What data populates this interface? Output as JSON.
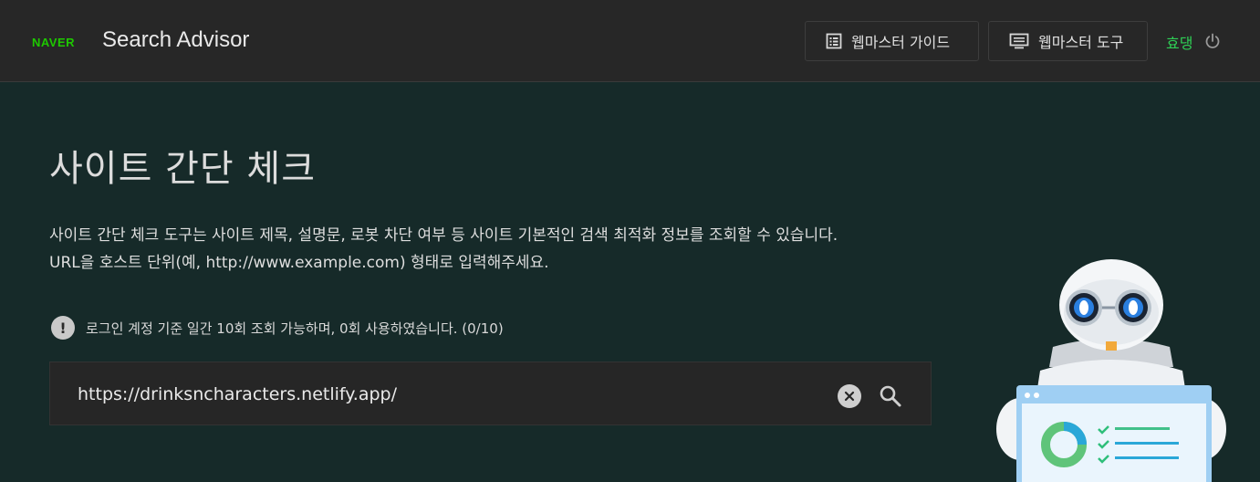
{
  "header": {
    "brand": "NAVER",
    "product": "Search Advisor",
    "guide_label": "웹마스터 가이드",
    "tool_label": "웹마스터 도구",
    "user": "효댕"
  },
  "main": {
    "title": "사이트 간단 체크",
    "desc_line1": "사이트 간단 체크 도구는 사이트 제목, 설명문, 로봇 차단 여부 등 사이트 기본적인 검색 최적화 정보를 조회할 수 있습니다.",
    "desc_line2": "URL을 호스트 단위(예, http://www.example.com) 형태로 입력해주세요.",
    "notice": "로그인 계정 기준 일간 10회 조회 가능하며, 0회 사용하였습니다. (0/10)",
    "notice_icon": "!",
    "search_value": "https://drinksncharacters.netlify.app/"
  },
  "colors": {
    "brand_green": "#1ec800",
    "user_green": "#2fce55",
    "background": "#162a29",
    "header_bg": "#272727"
  },
  "icons": [
    "guide-list-icon",
    "monitor-icon",
    "power-icon",
    "clear-icon",
    "search-icon",
    "robot-mascot"
  ]
}
